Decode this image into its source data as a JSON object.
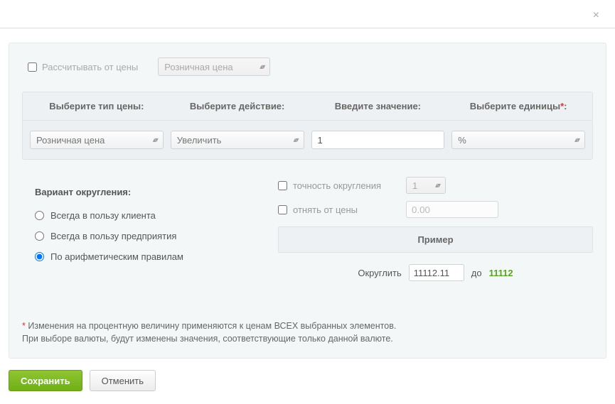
{
  "top": {
    "calc_from_price_label": "Рассчитывать от цены",
    "calc_from_price_checked": false,
    "price_source_value": "Розничная цена"
  },
  "headers": {
    "price_type": "Выберите тип цены:",
    "action": "Выберите действие:",
    "value": "Введите значение:",
    "units": "Выберите единицы",
    "units_req": "*"
  },
  "row": {
    "price_type_value": "Розничная цена",
    "action_value": "Увеличить",
    "value_input": "1",
    "units_value": "%"
  },
  "rounding": {
    "title": "Вариант округления:",
    "opt_client": "Всегда в пользу клиента",
    "opt_company": "Всегда в пользу предприятия",
    "opt_arith": "По арифметическим правилам",
    "selected": "arith"
  },
  "right": {
    "precision_label": "точность округления",
    "precision_checked": false,
    "precision_value": "1",
    "subtract_label": "отнять от цены",
    "subtract_checked": false,
    "subtract_value": "0.00"
  },
  "example": {
    "title": "Пример",
    "round_label": "Округлить",
    "input_value": "11112.11",
    "to_label": "до",
    "result": "11112"
  },
  "note": {
    "asterisk": "*",
    "line1": "Изменения на процентную величину применяются к ценам ВСЕХ выбранных элементов.",
    "line2": "При выборе валюты, будут изменены значения, соответствующие только данной валюте."
  },
  "footer": {
    "save": "Сохранить",
    "cancel": "Отменить"
  }
}
